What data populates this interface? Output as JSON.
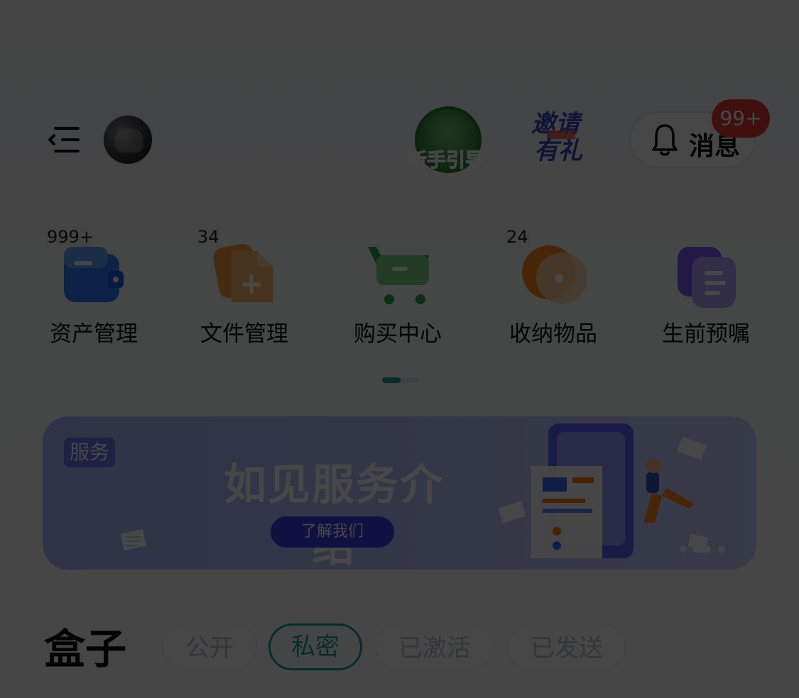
{
  "header": {
    "menu_icon": "menu-icon",
    "avatar_icon": "avatar",
    "guide_label": "新手引导",
    "invite_line1": "邀请",
    "invite_line2": "有礼",
    "message_label": "消息",
    "message_count": "99+"
  },
  "quick_actions": [
    {
      "label": "资产管理",
      "count": "999+",
      "icon": "wallet-icon",
      "color": "#2f7bff"
    },
    {
      "label": "文件管理",
      "count": "34",
      "icon": "file-add-icon",
      "color": "#ff7a1a"
    },
    {
      "label": "购买中心",
      "count": "",
      "icon": "cart-icon",
      "color": "#2ea84a"
    },
    {
      "label": "收纳物品",
      "count": "24",
      "icon": "storage-icon",
      "color": "#ff7a1a"
    },
    {
      "label": "生前预嘱",
      "count": "",
      "icon": "document-icon",
      "color": "#7b5cff"
    }
  ],
  "banner": {
    "tag": "服务",
    "title": "如见服务介绍",
    "button": "了解我们"
  },
  "section": {
    "title": "盒子",
    "filters": [
      {
        "label": "公开",
        "active": false
      },
      {
        "label": "私密",
        "active": true
      },
      {
        "label": "已激活",
        "active": false
      },
      {
        "label": "已发送",
        "active": false
      }
    ]
  },
  "colors": {
    "accent": "#19a08b",
    "badge": "#e53935",
    "banner": "#b7c2ff"
  }
}
